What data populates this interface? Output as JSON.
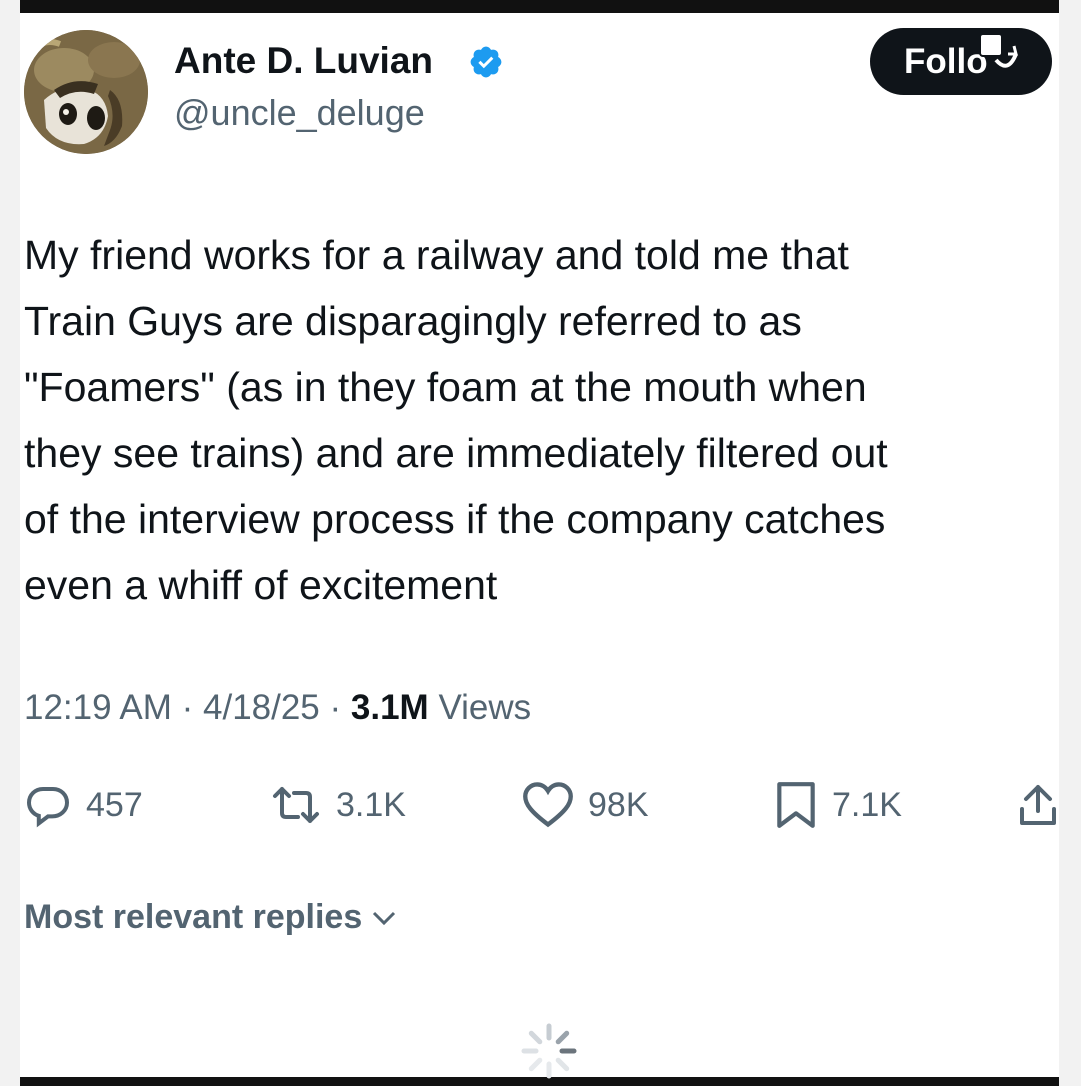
{
  "user": {
    "display_name": "Ante D. Luvian",
    "handle": "@uncle_deluge",
    "verified_icon": "verified-badge-icon",
    "follow_label": "Follo"
  },
  "tweet": {
    "lines": [
      "My friend works for a railway and told me that",
      "Train Guys are disparagingly referred to as",
      "\"Foamers\" (as in they foam at the mouth when",
      "they see trains) and are immediately filtered out",
      "of the interview process if the company catches",
      "even a whiff of excitement"
    ],
    "time": "12:19 AM",
    "date": "4/18/25",
    "views_count": "3.1M",
    "views_label": "Views"
  },
  "actions": {
    "replies": "457",
    "reposts": "3.1K",
    "likes": "98K",
    "bookmarks": "7.1K"
  },
  "replies_section": {
    "sort_label": "Most relevant replies"
  },
  "colors": {
    "text_primary": "#0f1419",
    "text_secondary": "#536471",
    "verified_blue": "#1d9bf0",
    "follow_bg": "#0f1419"
  }
}
